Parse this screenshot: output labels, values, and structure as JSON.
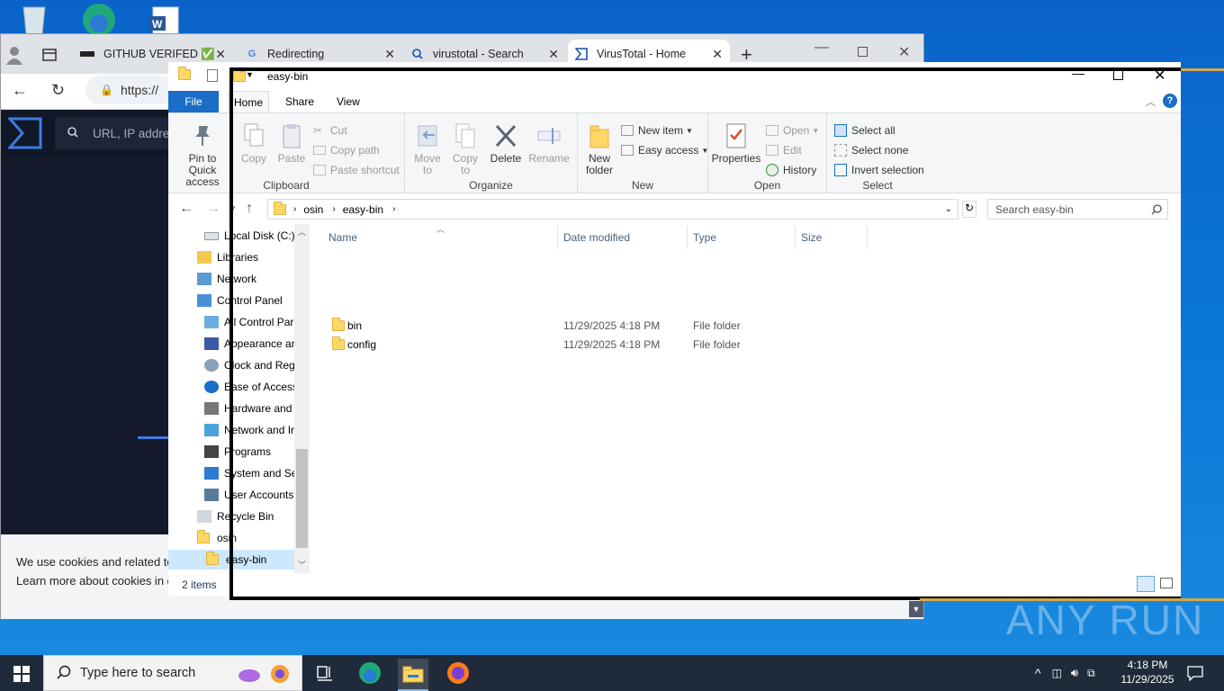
{
  "browser": {
    "tabs": [
      {
        "label": "GITHUB VERIFED ✅"
      },
      {
        "label": "Redirecting"
      },
      {
        "label": "virustotal - Search"
      },
      {
        "label": "VirusTotal - Home"
      }
    ],
    "new_tab": "+",
    "address": "https://",
    "vt_search_placeholder": "URL, IP addres",
    "cookie_line1": "We use cookies and related te",
    "cookie_line2": "Learn more about cookies in o"
  },
  "explorer": {
    "title": "easy-bin",
    "ribbon_tabs": {
      "file": "File",
      "home": "Home",
      "share": "Share",
      "view": "View"
    },
    "clipboard": {
      "pin": "Pin to Quick access",
      "copy": "Copy",
      "paste": "Paste",
      "cut": "Cut",
      "copy_path": "Copy path",
      "paste_shortcut": "Paste shortcut",
      "label": "Clipboard"
    },
    "organize": {
      "move_to": "Move to",
      "copy_to": "Copy to",
      "delete": "Delete",
      "rename": "Rename",
      "label": "Organize"
    },
    "new": {
      "new_folder": "New folder",
      "new_item": "New item",
      "easy_access": "Easy access",
      "label": "New"
    },
    "open": {
      "properties": "Properties",
      "open": "Open",
      "edit": "Edit",
      "history": "History",
      "label": "Open"
    },
    "select": {
      "select_all": "Select all",
      "select_none": "Select none",
      "invert": "Invert selection",
      "label": "Select"
    },
    "path": [
      "osin",
      "easy-bin"
    ],
    "search_placeholder": "Search easy-bin",
    "nav_items": [
      {
        "label": "Local Disk (C:)"
      },
      {
        "label": "Libraries"
      },
      {
        "label": "Network"
      },
      {
        "label": "Control Panel"
      },
      {
        "label": "All Control Par"
      },
      {
        "label": "Appearance an"
      },
      {
        "label": "Clock and Regi"
      },
      {
        "label": "Ease of Access"
      },
      {
        "label": "Hardware and"
      },
      {
        "label": "Network and Ir"
      },
      {
        "label": "Programs"
      },
      {
        "label": "System and Se"
      },
      {
        "label": "User Accounts"
      },
      {
        "label": "Recycle Bin"
      },
      {
        "label": "osin"
      },
      {
        "label": "easy-bin"
      }
    ],
    "columns": {
      "name": "Name",
      "date": "Date modified",
      "type": "Type",
      "size": "Size"
    },
    "files": [
      {
        "name": "bin",
        "date": "11/29/2025 4:18 PM",
        "type": "File folder",
        "size": ""
      },
      {
        "name": "config",
        "date": "11/29/2025 4:18 PM",
        "type": "File folder",
        "size": ""
      }
    ],
    "status": "2 items"
  },
  "taskbar": {
    "search_placeholder": "Type here to search",
    "time": "4:18 PM",
    "date": "11/29/2025"
  },
  "watermark": "ANY RUN",
  "colors": {
    "accent": "#1a6ec7",
    "desktop": "#0a6fd1",
    "taskbar": "#1f2a3a"
  }
}
